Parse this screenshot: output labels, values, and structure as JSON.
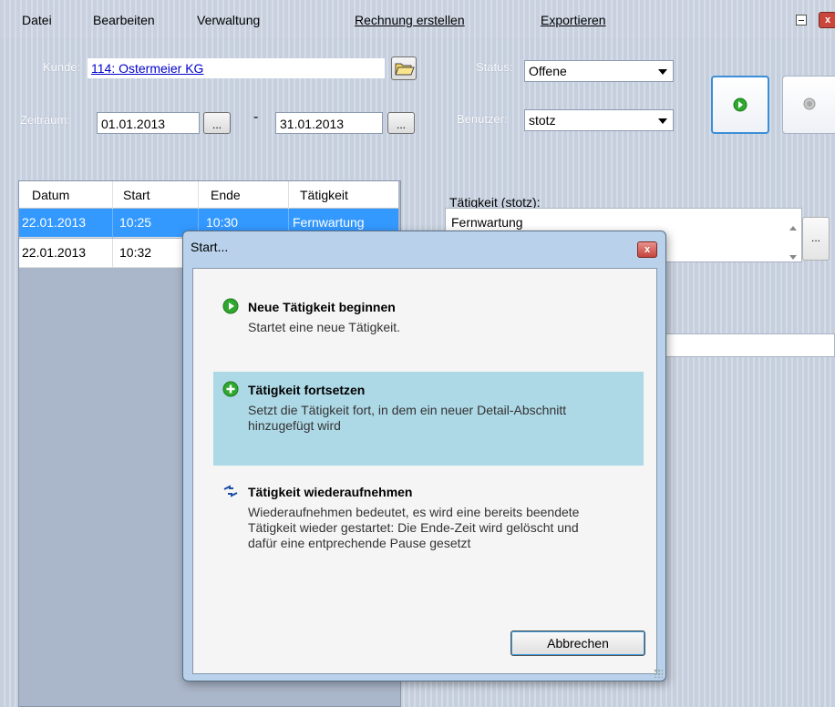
{
  "menu": {
    "datei": "Datei",
    "bearbeiten": "Bearbeiten",
    "verwaltung": "Verwaltung",
    "rechnung": "Rechnung erstellen",
    "exportieren": "Exportieren"
  },
  "filters": {
    "kunde_label": "Kunde:",
    "kunde_value": "114: Ostermeier KG",
    "zeitraum_label": "Zeitraum:",
    "from_date": "01.01.2013",
    "dash": "-",
    "to_date": "31.01.2013",
    "dots": "...",
    "status_label": "Status:",
    "status_value": "Offene",
    "benutzer_label": "Benutzer:",
    "benutzer_value": "stotz"
  },
  "table": {
    "columns": [
      "Datum",
      "Start",
      "Ende",
      "Tätigkeit"
    ],
    "rows": [
      {
        "datum": "22.01.2013",
        "start": "10:25",
        "ende": "10:30",
        "taetigkeit": "Fernwartung"
      },
      {
        "datum": "22.01.2013",
        "start": "10:32",
        "ende": "",
        "taetigkeit": ""
      }
    ]
  },
  "detail": {
    "label": "Tätigkeit (stotz):",
    "value": "Fernwartung",
    "dots": "..."
  },
  "dialog": {
    "title": "Start...",
    "close": "x",
    "options": [
      {
        "title": "Neue Tätigkeit beginnen",
        "desc": "Startet eine neue Tätigkeit."
      },
      {
        "title": "Tätigkeit fortsetzen",
        "desc": "Setzt die Tätigkeit fort, in dem ein neuer Detail-Abschnitt hinzugefügt wird"
      },
      {
        "title": "Tätigkeit wiederaufnehmen",
        "desc": "Wiederaufnehmen bedeutet, es wird eine bereits beendete Tätigkeit wieder gestartet: Die Ende-Zeit wird gelöscht und dafür eine entprechende Pause gesetzt"
      }
    ],
    "cancel": "Abbrechen"
  },
  "colors": {
    "selection": "#3399ff",
    "highlight_option": "#add8e6",
    "play_green": "#2fa82f"
  }
}
